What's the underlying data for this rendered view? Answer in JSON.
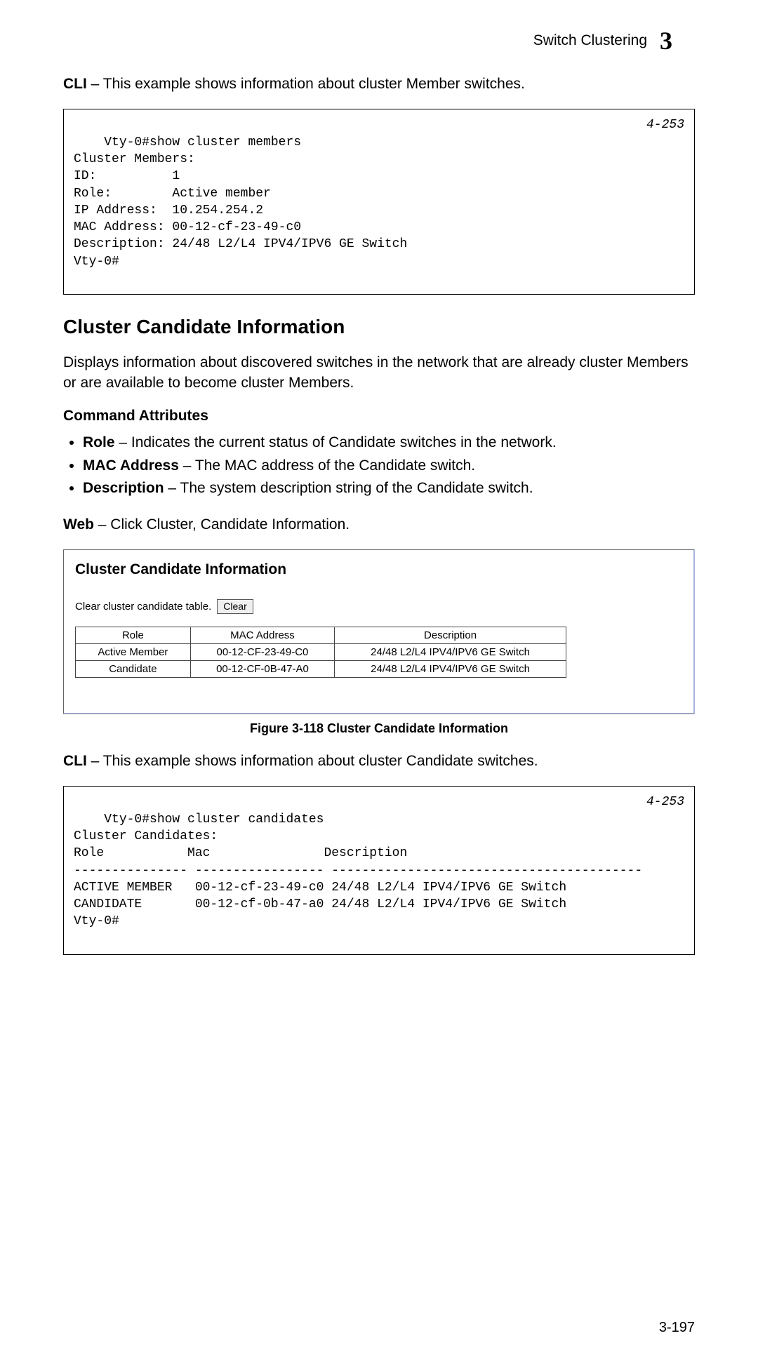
{
  "header": {
    "section_title": "Switch Clustering",
    "chapter_number": "3"
  },
  "cli_intro_1_bold": "CLI",
  "cli_intro_1_rest": " – This example shows information about cluster Member switches.",
  "code1": {
    "ref": "4-253",
    "text": "Vty-0#show cluster members\nCluster Members:\nID:          1\nRole:        Active member\nIP Address:  10.254.254.2\nMAC Address: 00-12-cf-23-49-c0\nDescription: 24/48 L2/L4 IPV4/IPV6 GE Switch\nVty-0#"
  },
  "section_heading": "Cluster Candidate Information",
  "section_body": "Displays information about discovered switches in the network that are already cluster Members or are available to become cluster Members.",
  "cmd_attr_heading": "Command Attributes",
  "attrs": [
    {
      "term": "Role",
      "desc": " – Indicates the current status of Candidate switches in the network."
    },
    {
      "term": "MAC Address",
      "desc": " – The MAC address of the Candidate switch."
    },
    {
      "term": "Description",
      "desc": " – The system description string of the Candidate switch."
    }
  ],
  "web_line_bold": "Web",
  "web_line_rest": " – Click Cluster, Candidate Information.",
  "web_figure": {
    "title": "Cluster Candidate Information",
    "clear_label": "Clear cluster candidate table.",
    "clear_button": "Clear",
    "columns": [
      "Role",
      "MAC Address",
      "Description"
    ],
    "rows": [
      [
        "Active Member",
        "00-12-CF-23-49-C0",
        "24/48 L2/L4 IPV4/IPV6 GE Switch"
      ],
      [
        "Candidate",
        "00-12-CF-0B-47-A0",
        "24/48 L2/L4 IPV4/IPV6 GE Switch"
      ]
    ]
  },
  "figure_caption": "Figure 3-118  Cluster Candidate Information",
  "cli_intro_2_bold": "CLI",
  "cli_intro_2_rest": " – This example shows information about cluster Candidate switches.",
  "code2": {
    "ref": "4-253",
    "text": "Vty-0#show cluster candidates\nCluster Candidates:\nRole           Mac               Description\n--------------- ----------------- -----------------------------------------\nACTIVE MEMBER   00-12-cf-23-49-c0 24/48 L2/L4 IPV4/IPV6 GE Switch\nCANDIDATE       00-12-cf-0b-47-a0 24/48 L2/L4 IPV4/IPV6 GE Switch\nVty-0#"
  },
  "page_number": "3-197"
}
